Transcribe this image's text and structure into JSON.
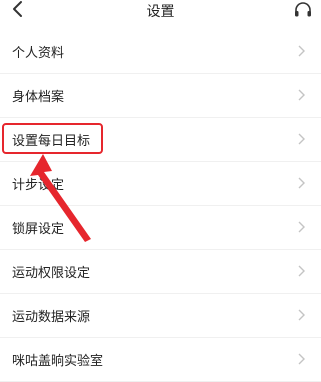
{
  "header": {
    "title": "设置",
    "back_icon": "back-chevron-icon",
    "support_icon": "headset-icon"
  },
  "settings": {
    "items": [
      {
        "label": "个人资料"
      },
      {
        "label": "身体档案"
      },
      {
        "label": "设置每日目标"
      },
      {
        "label": "计步设定"
      },
      {
        "label": "锁屏设定"
      },
      {
        "label": "运动权限设定"
      },
      {
        "label": "运动数据来源"
      },
      {
        "label": "咪咕盖晌实验室"
      }
    ],
    "chevron_icon": "chevron-right-icon"
  },
  "annotation": {
    "highlight_color": "#e6262d",
    "highlighted_item": "设置每日目标"
  }
}
